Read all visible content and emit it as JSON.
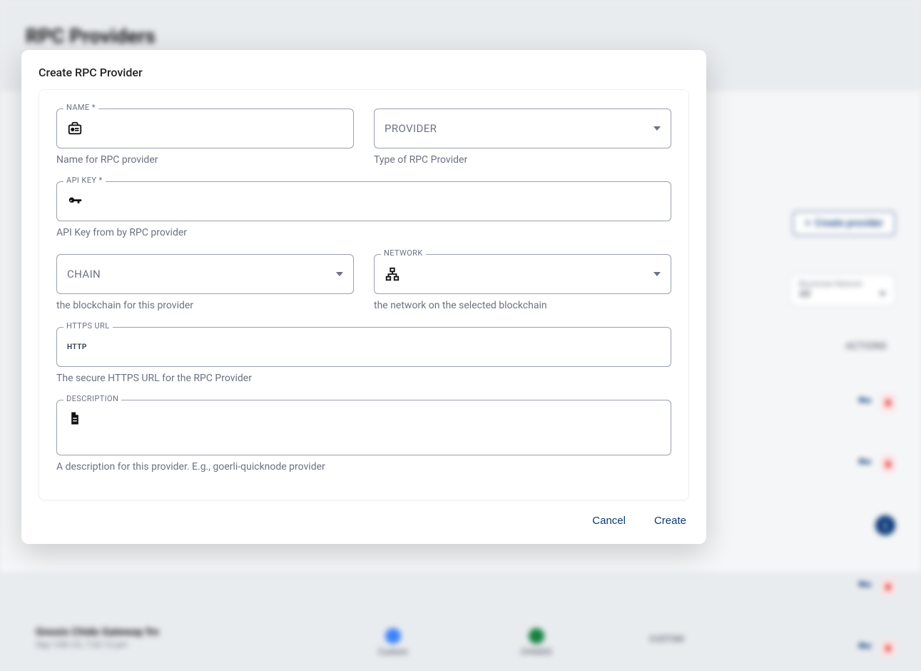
{
  "page": {
    "title": "RPC Providers",
    "create_button": "Create provider",
    "filter_label": "Blockchain Network",
    "filter_value": "All",
    "actions_header": "ACTIONS",
    "row_item_title": "Gnosis Chido Gateway fm",
    "row_item_sub": "Sep 12th 23, 7:32:13 pm",
    "chip_custom": "Custom",
    "chip_chiado": "CHIADO",
    "chip_custom2": "CUSTOM"
  },
  "modal": {
    "title": "Create RPC Provider",
    "fields": {
      "name": {
        "label": "NAME *",
        "helper": "Name for RPC provider"
      },
      "provider": {
        "placeholder": "PROVIDER",
        "helper": "Type of RPC Provider"
      },
      "apikey": {
        "label": "API KEY *",
        "helper": "API Key from by RPC provider"
      },
      "chain": {
        "placeholder": "CHAIN",
        "helper": "the blockchain for this provider"
      },
      "network": {
        "label": "NETWORK",
        "helper": "the network on the selected blockchain"
      },
      "https": {
        "label": "HTTPS URL",
        "helper": "The secure HTTPS URL for the RPC Provider",
        "badge": "HTTP"
      },
      "desc": {
        "label": "DESCRIPTION",
        "helper": "A description for this provider. E.g., goerli-quicknode provider"
      }
    },
    "footer": {
      "cancel": "Cancel",
      "create": "Create"
    }
  }
}
